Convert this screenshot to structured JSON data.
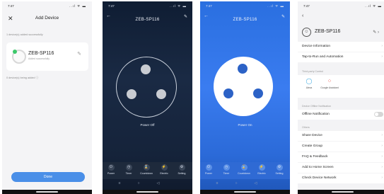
{
  "status": {
    "time": "7:47",
    "signal": "..ıl ᯤ ▬"
  },
  "screen1": {
    "title": "Add Device",
    "added_label": "1 device(s) added successfully",
    "device_name": "ZEB-SP116",
    "device_sub": "Added successfully",
    "being_added_label": "0 device(s) being added",
    "done_label": "Done"
  },
  "screen2": {
    "title": "ZEB-SP116",
    "state": "Power Off",
    "buttons": [
      "Power",
      "Timer",
      "Countdown",
      "Electric",
      "Setting"
    ]
  },
  "screen3": {
    "title": "ZEB-SP116",
    "state": "Power On",
    "buttons": [
      "Power",
      "Timer",
      "Countdown",
      "Electric",
      "Setting"
    ]
  },
  "screen4": {
    "device_name": "ZEB-SP116",
    "rows_top": [
      "Device Information",
      "Tap-to-Run and Automation"
    ],
    "third_party_label": "Third-party Control",
    "third_party": [
      "Alexa",
      "Google Assistant"
    ],
    "offline_section": "Device Offline Notification",
    "offline_label": "Offline Notification",
    "offline_enabled": false,
    "others_label": "Others",
    "rows_others": [
      "Share Device",
      "Create Group",
      "FAQ & Feedback",
      "Add to Home Screen",
      "Check Device Network"
    ]
  },
  "colors": {
    "accent": "#4a8fe8",
    "power_on_bg": "#2f6ad4",
    "power_off_bg": "#15233a"
  }
}
